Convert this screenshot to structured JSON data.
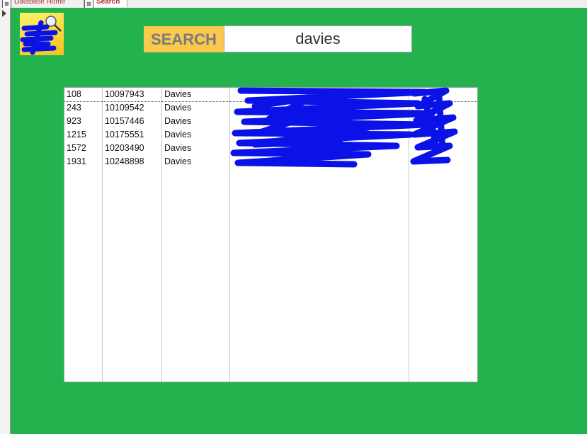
{
  "tabs": [
    {
      "label": "Database Home",
      "icon": "form-icon"
    },
    {
      "label": "Search",
      "icon": "form-icon",
      "active": true
    }
  ],
  "search": {
    "label": "SEARCH",
    "value": "davies"
  },
  "results": {
    "rows": [
      {
        "id": "108",
        "number": "10097943",
        "surname": "Davies",
        "address": "",
        "postcode": ""
      },
      {
        "id": "243",
        "number": "10109542",
        "surname": "Davies",
        "address": "",
        "postcode": ""
      },
      {
        "id": "923",
        "number": "10157446",
        "surname": "Davies",
        "address": "",
        "postcode": ""
      },
      {
        "id": "1215",
        "number": "10175551",
        "surname": "Davies",
        "address": "",
        "postcode": ""
      },
      {
        "id": "1572",
        "number": "10203490",
        "surname": "Davies",
        "address": "",
        "postcode": ""
      },
      {
        "id": "1931",
        "number": "10248898",
        "surname": "Davies",
        "address": "",
        "postcode": ""
      }
    ]
  },
  "colors": {
    "form_background": "#24b24f",
    "search_label_background": "#f9c84f",
    "redaction": "#0a12e8"
  }
}
